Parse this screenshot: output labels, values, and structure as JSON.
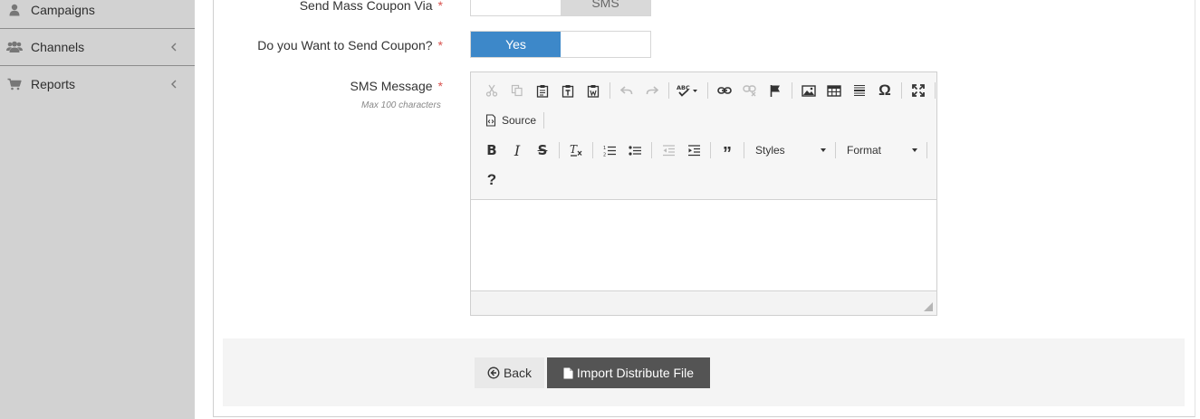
{
  "sidebar": {
    "items": [
      {
        "label": "Campaigns",
        "icon": "user-icon"
      },
      {
        "label": "Channels",
        "icon": "users-icon"
      },
      {
        "label": "Reports",
        "icon": "cart-icon"
      }
    ]
  },
  "form": {
    "send_via": {
      "label": "Send Mass Coupon Via",
      "required_mark": "*",
      "option_left": "",
      "option_right": "SMS"
    },
    "send_coupon": {
      "label": "Do you Want to Send Coupon?",
      "required_mark": "*",
      "option_yes": "Yes",
      "option_no": ""
    },
    "sms_message": {
      "label": "SMS Message",
      "required_mark": "*",
      "hint": "Max 100 characters"
    }
  },
  "editor": {
    "source_label": "Source",
    "styles_label": "Styles",
    "format_label": "Format",
    "help_label": "?",
    "content": ""
  },
  "actions": {
    "back_label": "Back",
    "import_label": "Import Distribute File"
  },
  "colors": {
    "sidebar_bg": "#d2d2d2",
    "toggle_active": "#3d88c9",
    "import_button": "#545454",
    "required": "#d9534f"
  }
}
